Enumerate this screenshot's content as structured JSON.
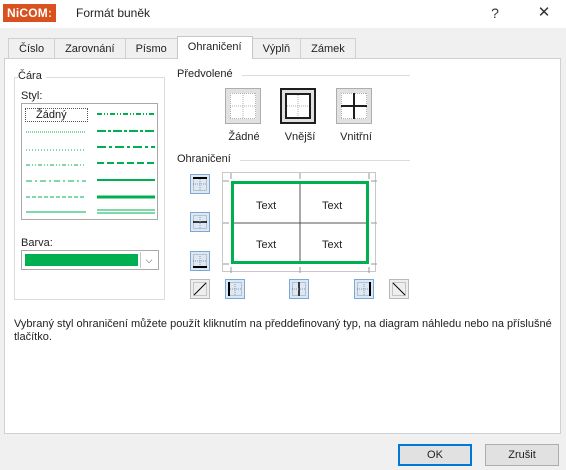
{
  "window": {
    "logo_text": "NiCOM",
    "logo_colon": ":",
    "title": "Formát buněk",
    "help_glyph": "?",
    "close_glyph": "✕"
  },
  "tabs": [
    {
      "label": "Číslo",
      "active": false
    },
    {
      "label": "Zarovnání",
      "active": false
    },
    {
      "label": "Písmo",
      "active": false
    },
    {
      "label": "Ohraničení",
      "active": true
    },
    {
      "label": "Výplň",
      "active": false
    },
    {
      "label": "Zámek",
      "active": false
    }
  ],
  "line_group": {
    "label": "Čára",
    "style_label": "Styl:",
    "style_none": "Žádný",
    "color_label": "Barva:",
    "color_value": "#00b050"
  },
  "presets": {
    "label": "Předvolené",
    "items": [
      {
        "label": "Žádné",
        "icon": "preset-none-icon"
      },
      {
        "label": "Vnější",
        "icon": "preset-outline-icon"
      },
      {
        "label": "Vnitřní",
        "icon": "preset-inside-icon"
      }
    ]
  },
  "border": {
    "label": "Ohraničení",
    "cells": [
      "Text",
      "Text",
      "Text",
      "Text"
    ],
    "line_color": "#00b050"
  },
  "hint": "Vybraný styl ohraničení můžete použít kliknutím na předdefinovaný typ, na diagram náhledu nebo na příslušné tlačítko.",
  "buttons": {
    "ok": "OK",
    "cancel": "Zrušit"
  }
}
